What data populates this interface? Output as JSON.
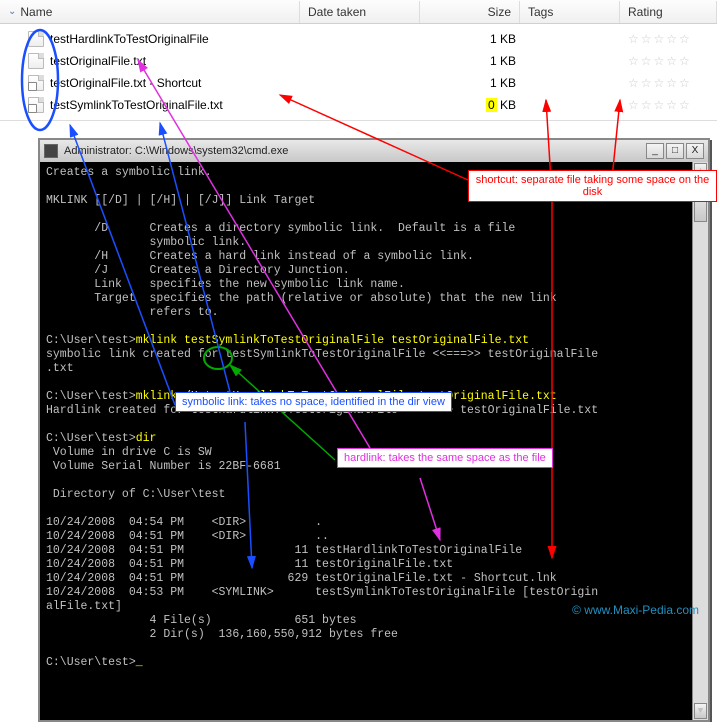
{
  "columns": {
    "name": "Name",
    "date": "Date taken",
    "size": "Size",
    "tags": "Tags",
    "rating": "Rating"
  },
  "files": [
    {
      "name": "testHardlinkToTestOriginalFile",
      "size": "1 KB",
      "icon": "doc"
    },
    {
      "name": "testOriginalFile.txt",
      "size": "1 KB",
      "icon": "doc"
    },
    {
      "name": "testOriginalFile.txt - Shortcut",
      "size": "1 KB",
      "icon": "shortcut"
    },
    {
      "name": "testSymlinkToTestOriginalFile.txt",
      "size": "0 KB",
      "icon": "shortcut",
      "highlight": true
    }
  ],
  "stars": "☆☆☆☆☆",
  "cmd": {
    "title": "Administrator: C:\\Windows\\system32\\cmd.exe",
    "lines": [
      {
        "t": "Creates a symbolic link."
      },
      {
        "t": ""
      },
      {
        "t": "MKLINK [[/D] | [/H] | [/J]] Link Target"
      },
      {
        "t": ""
      },
      {
        "t": "       /D      Creates a directory symbolic link.  Default is a file"
      },
      {
        "t": "               symbolic link."
      },
      {
        "t": "       /H      Creates a hard link instead of a symbolic link."
      },
      {
        "t": "       /J      Creates a Directory Junction."
      },
      {
        "t": "       Link    specifies the new symbolic link name."
      },
      {
        "t": "       Target  specifies the path (relative or absolute) that the new link"
      },
      {
        "t": "               refers to."
      },
      {
        "t": ""
      },
      {
        "p": "C:\\User\\test>",
        "c": "mklink testSymlinkToTestOriginalFile testOriginalFile.txt"
      },
      {
        "t": "symbolic link created for testSymlinkToTestOriginalFile <<===>> testOriginalFile"
      },
      {
        "t": ".txt"
      },
      {
        "t": ""
      },
      {
        "p": "C:\\User\\test>",
        "c": "mklink /H testHardlinkToTestOriginalFile testOriginalFile.txt"
      },
      {
        "t": "Hardlink created for testHardlinkToTestOriginalFile <<===>> testOriginalFile.txt"
      },
      {
        "t": ""
      },
      {
        "p": "C:\\User\\test>",
        "c": "dir"
      },
      {
        "t": " Volume in drive C is SW"
      },
      {
        "t": " Volume Serial Number is 22BF-6681"
      },
      {
        "t": ""
      },
      {
        "t": " Directory of C:\\User\\test"
      },
      {
        "t": ""
      },
      {
        "t": "10/24/2008  04:54 PM    <DIR>          ."
      },
      {
        "t": "10/24/2008  04:51 PM    <DIR>          .."
      },
      {
        "t": "10/24/2008  04:51 PM                11 testHardlinkToTestOriginalFile"
      },
      {
        "t": "10/24/2008  04:51 PM                11 testOriginalFile.txt"
      },
      {
        "t": "10/24/2008  04:51 PM               629 testOriginalFile.txt - Shortcut.lnk"
      },
      {
        "t": "10/24/2008  04:53 PM    <SYMLINK>      testSymlinkToTestOriginalFile [testOrigin"
      },
      {
        "t": "alFile.txt]"
      },
      {
        "t": "               4 File(s)            651 bytes"
      },
      {
        "t": "               2 Dir(s)  136,160,550,912 bytes free"
      },
      {
        "t": ""
      },
      {
        "p": "C:\\User\\test>",
        "c": "_"
      }
    ]
  },
  "annotations": {
    "shortcut": "shortcut: separate file taking\nsome space on the disk",
    "symlink": "symbolic link: takes no space,\nidentified in the dir view",
    "hardlink": "hardlink: takes the same\nspace as the file"
  },
  "watermark": "© www.Maxi-Pedia.com",
  "buttons": {
    "min": "_",
    "max": "□",
    "close": "X"
  }
}
